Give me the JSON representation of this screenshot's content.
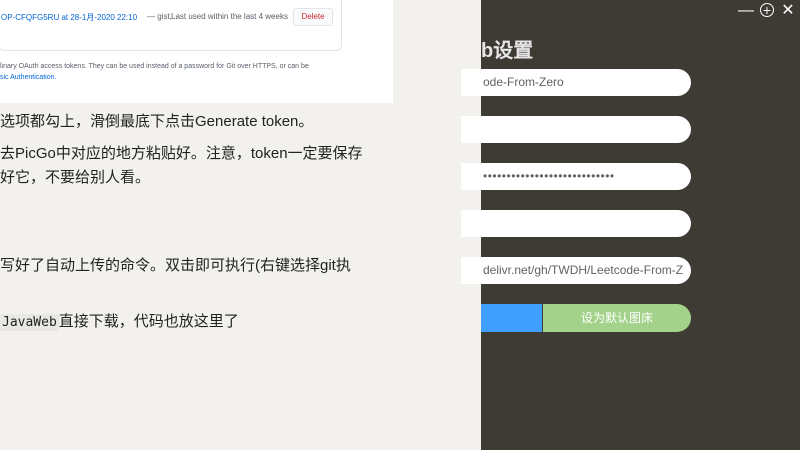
{
  "article": {
    "screenshot": {
      "token_name": "OP-CFQFG5RU at 28-1月-2020 22:10",
      "token_scope": "— gist,",
      "token_last_used": "Last used within the last 4 weeks",
      "delete_label": "Delete",
      "note_line1": "linary OAuth access tokens. They can be used instead of a password for Git over HTTPS, or can be",
      "note_line2": "sic Authentication."
    },
    "para1": "选项都勾上，滑倒最底下点击Generate token。",
    "para2": "去PicGo中对应的地方粘贴好。注意，token一定要保存",
    "para3": "好它，不要给别人看。",
    "para4": "写好了自动上传的命令。双击即可执行(右键选择git执",
    "para5_code": "JavaWeb",
    "para5_text": "直接下载，代码也放这里了"
  },
  "panel": {
    "title": "b设置",
    "fields": {
      "repo": "ode-From-Zero",
      "branch": "",
      "token": "••••••••••••••••••••••••••••",
      "path": "",
      "domain": "delivr.net/gh/TWDH/Leetcode-From-Z"
    },
    "confirm_label": "",
    "default_label": "设为默认图床"
  },
  "window": {
    "minimize_glyph": "—",
    "add_glyph": "+",
    "close_glyph": "✕"
  },
  "colors": {
    "panel_bg": "#3e3a34",
    "confirm": "#409eff",
    "default": "#a3d38a"
  }
}
